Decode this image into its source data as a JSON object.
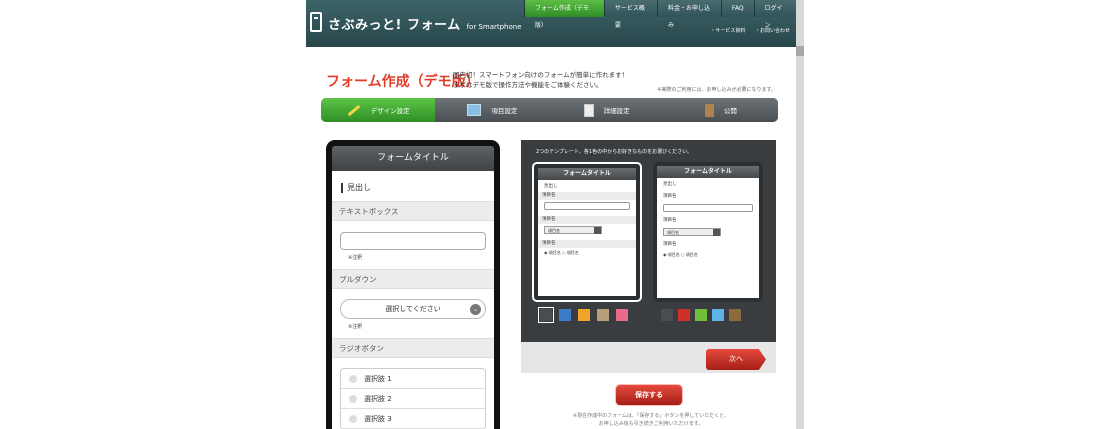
{
  "header": {
    "brand": "さぶみっと! フォーム",
    "brand_suffix": "for Smartphone",
    "nav": [
      {
        "label": "フォーム作成（デモ版）",
        "active": true
      },
      {
        "label": "サービス概要",
        "active": false
      },
      {
        "label": "料金・お申し込み",
        "active": false
      },
      {
        "label": "FAQ",
        "active": false
      },
      {
        "label": "ログイン",
        "active": false
      }
    ],
    "subnav": [
      "・サービス資料",
      "・お問い合わせ"
    ]
  },
  "page": {
    "title": "フォーム作成（デモ版）",
    "intro_line1": "国内初！スマートフォン向けのフォームが簡単に作れます！",
    "intro_line2": "まずはデモ版で操作方法や機能をご体験ください。",
    "notice": "※実際のご利用には、お申し込みが必要になります。"
  },
  "steps": [
    {
      "label": "デザイン設定",
      "active": true
    },
    {
      "label": "項目設定",
      "active": false
    },
    {
      "label": "詳細設定",
      "active": false
    },
    {
      "label": "公開",
      "active": false
    }
  ],
  "preview": {
    "form_title": "フォームタイトル",
    "heading": "見出し",
    "textbox_section": "テキストボックス",
    "note": "※注釈",
    "pulldown_section": "プルダウン",
    "select_placeholder": "選択してください",
    "radio_section": "ラジオボタン",
    "radio_options": [
      "選択肢 1",
      "選択肢 2",
      "選択肢 3"
    ]
  },
  "templates": {
    "instruction": "2つのテンプレート、各1色の中からお好きなものをお選びください。",
    "card_title": "フォームタイトル",
    "heading": "見出し",
    "field_label": "項目名",
    "select_value": "項目名",
    "radio_a": "項目名",
    "radio_b": "項目名",
    "colors_1": [
      "#4a4d50",
      "#3b7bc8",
      "#f2a52a",
      "#b79f7c",
      "#e86b8a"
    ],
    "colors_2": [
      "#4a4d50",
      "#d0302a",
      "#6fbf3a",
      "#5fb2e6",
      "#8b6a3c"
    ]
  },
  "actions": {
    "next": "次へ",
    "save": "保存する",
    "save_note_1": "※現在作成中のフォームは、「保存する」ボタンを押していただくと、",
    "save_note_2": "お申し込み後も引き続きご利用いただけます。"
  }
}
